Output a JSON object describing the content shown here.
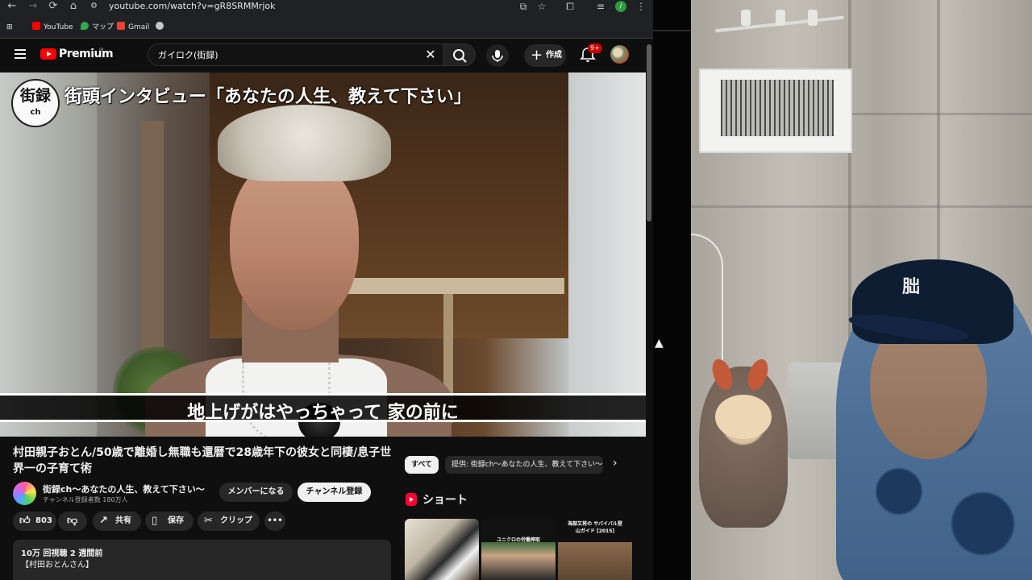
{
  "browser": {
    "url": "youtube.com/watch?v=gR8SRMMrjok",
    "profile_initial": "/",
    "bookmarks": [
      {
        "label": "YouTube",
        "color": "#ff0000"
      },
      {
        "label": "マップ",
        "color": "#34a853"
      },
      {
        "label": "Gmail",
        "color": "#ea4335"
      },
      {
        "label": "",
        "color": "#c4c7c5"
      }
    ]
  },
  "youtube": {
    "logo_text": "Premium",
    "logo_region": "JP",
    "search_value": "ガイロク(街録)",
    "create_label": "作成",
    "notification_count": "9+"
  },
  "video": {
    "channel_logo_top": "街録",
    "channel_logo_bottom": "ch",
    "overlay_title": "街頭インタビュー「あなたの人生、教えて下さい」",
    "subtitle": "地上げがはやっちゃって 家の前に",
    "title": "村田親子おとん/50歳で離婚し無職も還暦で28歳年下の彼女と同棲/息子世界一の子育て術",
    "channel_name": "街録ch〜あなたの人生、教えて下さい〜",
    "subscribers": "チャンネル登録者数 180万人",
    "membership_label": "メンバーになる",
    "subscribe_label": "チャンネル登録",
    "like_count": "803",
    "share_label": "共有",
    "save_label": "保存",
    "clip_label": "クリップ",
    "more_label": "•••",
    "views_date": "10万 回視聴  2 週間前",
    "description_first_line": "【村田おとんさん】"
  },
  "sidebar": {
    "chip_all": "すべて",
    "chip_provider": "提供: 街録ch〜あなたの人生、教えて下さい〜",
    "shorts_label": "ショート",
    "shorts": [
      {
        "caption": ""
      },
      {
        "caption": "ユニクロの労働搾取"
      },
      {
        "caption": "海部又将の サバイバル登山ガイド [2015]"
      }
    ]
  },
  "webcam": {
    "cap_logo": "朏"
  }
}
